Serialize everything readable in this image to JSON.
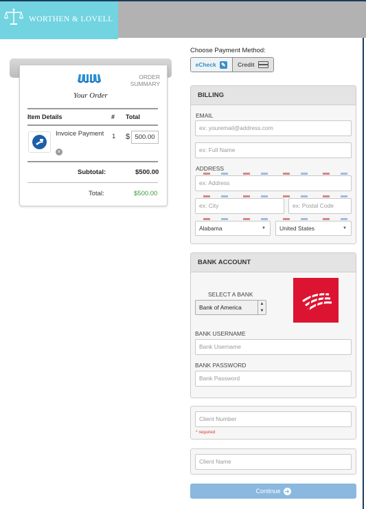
{
  "brand": {
    "name": "WORTHEN & LOVELL",
    "accent": "#71d4e0"
  },
  "receipt": {
    "order_summary": "ORDER SUMMARY",
    "your_order": "Your Order",
    "columns": [
      "Item Details",
      "#",
      "Total"
    ],
    "items": [
      {
        "name": "Invoice Payment",
        "qty": "1",
        "currency": "$",
        "amount": "500.00"
      }
    ],
    "subtotal_label": "Subtotal:",
    "subtotal_value": "$500.00",
    "total_label": "Total:",
    "total_value": "$500.00"
  },
  "payment_method": {
    "label": "Choose Payment Method:",
    "echeck": "eCheck",
    "credit": "Credit",
    "selected": "eCheck"
  },
  "billing": {
    "title": "BILLING",
    "email_label": "EMAIL",
    "email_placeholder": "ex: youremail@address.com",
    "name_placeholder": "ex: Full Name",
    "address_label": "ADDRESS",
    "address_placeholder": "ex: Address",
    "city_placeholder": "ex: City",
    "postal_placeholder": "ex: Postal Code",
    "state": "Alabama",
    "country": "United States"
  },
  "bank": {
    "title": "BANK ACCOUNT",
    "select_label": "SELECT A BANK",
    "selected_bank": "Bank of America",
    "username_label": "BANK USERNAME",
    "username_placeholder": "Bank Username",
    "password_label": "BANK PASSWORD",
    "password_placeholder": "Bank Password",
    "logo_color": "#dc1431"
  },
  "client": {
    "number_placeholder": "Client Number",
    "required": "* required",
    "name_placeholder": "Client Name"
  },
  "continue_label": "Continue"
}
